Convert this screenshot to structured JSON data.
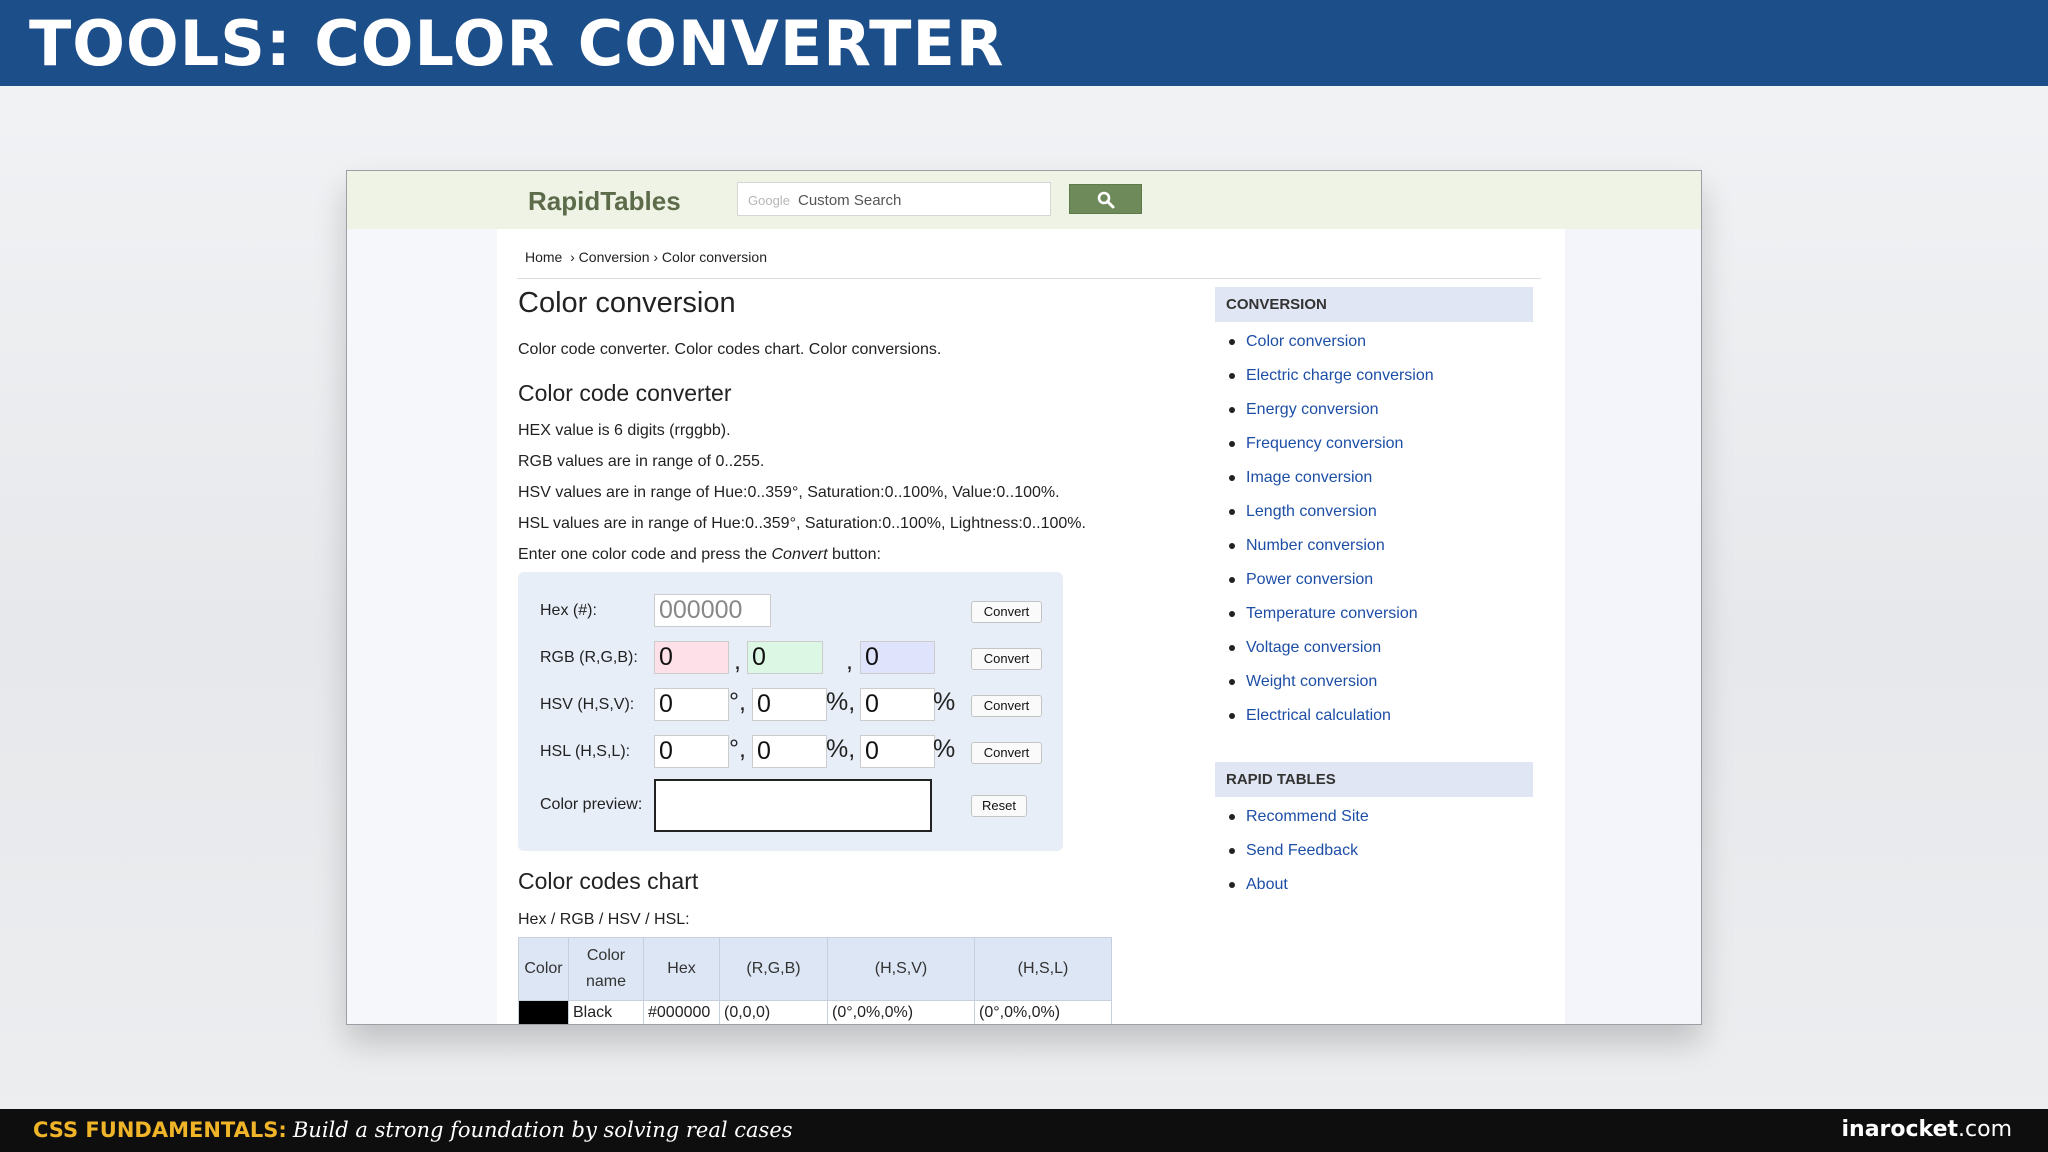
{
  "slide": {
    "title": "TOOLS: COLOR CONVERTER",
    "footer_course": "CSS FUNDAMENTALS:",
    "footer_tagline": "Build a strong foundation by solving real cases",
    "footer_brand_bold": "inarocket",
    "footer_brand_suffix": ".com"
  },
  "site": {
    "logo": "RapidTables",
    "search_google": "Google",
    "search_placeholder": "Custom Search",
    "search_icon": "search-icon"
  },
  "breadcrumb": "Home  › Conversion › Color conversion",
  "page": {
    "title": "Color conversion",
    "intro": "Color code converter. Color codes chart. Color conversions.",
    "converter_heading": "Color code converter",
    "paragraphs": [
      "HEX value is 6 digits (rrggbb).",
      "RGB values are in range of 0..255.",
      "HSV values are in range of Hue:0..359°, Saturation:0..100%, Value:0..100%.",
      "HSL values are in range of Hue:0..359°, Saturation:0..100%, Lightness:0..100%."
    ],
    "enter_prefix": "Enter one color code and press the ",
    "enter_em": "Convert",
    "enter_suffix": " button:"
  },
  "form": {
    "hex_label": "Hex (#):",
    "hex_value": "000000",
    "rgb_label": "RGB (R,G,B):",
    "rgb_values": [
      "0",
      "0",
      "0"
    ],
    "hsv_label": "HSV (H,S,V):",
    "hsv_values": [
      "0",
      "0",
      "0"
    ],
    "hsl_label": "HSL (H,S,L):",
    "hsl_values": [
      "0",
      "0",
      "0"
    ],
    "preview_label": "Color preview:",
    "convert_label": "Convert",
    "reset_label": "Reset",
    "sep_comma": ",",
    "sep_degree": "°,",
    "sep_percent_comma": "%,",
    "sep_percent": "%",
    "colors": {
      "r_field": "#fde0e8",
      "g_field": "#dcf7e4",
      "b_field": "#dfe3fb",
      "panel": "#e8eef8"
    }
  },
  "chart": {
    "heading": "Color codes chart",
    "subheading": "Hex / RGB / HSV / HSL:",
    "headers": [
      "Color",
      "Color name",
      "Hex",
      "(R,G,B)",
      "(H,S,V)",
      "(H,S,L)"
    ],
    "rows": [
      {
        "swatch": "#000000",
        "name": "Black",
        "hex": "#000000",
        "rgb": "(0,0,0)",
        "hsv": "(0°,0%,0%)",
        "hsl": "(0°,0%,0%)"
      }
    ]
  },
  "sidebar": {
    "conversion_heading": "CONVERSION",
    "conversion_items": [
      "Color conversion",
      "Electric charge conversion",
      "Energy conversion",
      "Frequency conversion",
      "Image conversion",
      "Length conversion",
      "Number conversion",
      "Power conversion",
      "Temperature conversion",
      "Voltage conversion",
      "Weight conversion",
      "Electrical calculation"
    ],
    "rapid_heading": "RAPID TABLES",
    "rapid_items": [
      "Recommend Site",
      "Send Feedback",
      "About"
    ]
  }
}
